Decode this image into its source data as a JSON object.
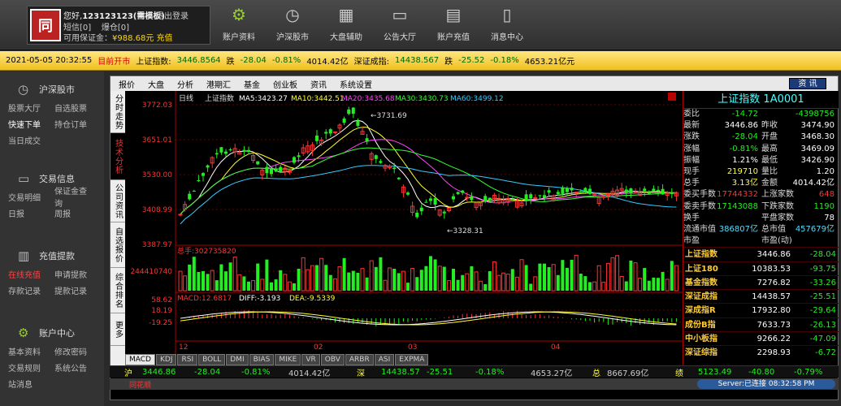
{
  "account": {
    "logo": "同",
    "greeting": "您好,",
    "user": "123123123(需模板)",
    "logout": "退出登录",
    "sms": "短信[0]",
    "alert": "爆仓[0]",
    "margin_label": "可用保证金：",
    "margin_value": "¥988.68元",
    "recharge": "充值"
  },
  "nav": [
    {
      "label": "账户资料",
      "icon": "gear-icon"
    },
    {
      "label": "沪深股市",
      "icon": "clock-icon"
    },
    {
      "label": "大盘辅助",
      "icon": "grid-icon"
    },
    {
      "label": "公告大厅",
      "icon": "monitor-icon"
    },
    {
      "label": "账户充值",
      "icon": "calendar-icon"
    },
    {
      "label": "消息中心",
      "icon": "message-icon"
    }
  ],
  "ticker": {
    "datetime": "2021-05-05 20:32:55",
    "market_status": "目前开市",
    "sh_name": "上证指数:",
    "sh_value": "3446.8564",
    "sh_dir": "跌",
    "sh_change": "-28.04",
    "sh_pct": "-0.81%",
    "sh_amount": "4014.42亿",
    "sz_name": "深证成指:",
    "sz_value": "14438.567",
    "sz_dir": "跌",
    "sz_change": "-25.52",
    "sz_pct": "-0.18%",
    "sz_amount": "4653.21亿元"
  },
  "sidebar": [
    {
      "title": "沪深股市",
      "icon": "clock-icon",
      "rows": [
        [
          "股票大厅",
          "自选股票"
        ],
        [
          "快速下单",
          "持仓订单"
        ],
        [
          "当日成交",
          ""
        ]
      ]
    },
    {
      "title": "交易信息",
      "icon": "monitor-icon",
      "rows": [
        [
          "交易明细",
          "保证金查询"
        ],
        [
          "日报",
          "周报"
        ]
      ]
    },
    {
      "title": "充值提款",
      "icon": "chart-icon",
      "rows": [
        [
          "在线充值",
          "申请提款"
        ],
        [
          "存款记录",
          "提款记录"
        ]
      ]
    },
    {
      "title": "账户中心",
      "icon": "gear-icon",
      "rows": [
        [
          "基本资料",
          "修改密码"
        ],
        [
          "交易规则",
          "系统公告"
        ],
        [
          "站消息",
          ""
        ]
      ]
    }
  ],
  "menu": [
    "报价",
    "大盘",
    "分析",
    "港期汇",
    "基金",
    "创业板",
    "资讯",
    "系统设置"
  ],
  "menu_button": "资 讯",
  "vtabs": [
    "分时走势",
    "技术分析",
    "公司资讯",
    "自选报价",
    "综合排名",
    "更多"
  ],
  "chart_labels": {
    "period": "日线",
    "index": "上证指数",
    "ma5": "MA5:3423.27",
    "ma10": "MA10:3442.51",
    "ma20": "MA20:3435.68",
    "ma30": "MA30:3430.73",
    "ma60": "MA60:3499.12",
    "hi_label": "3731.69",
    "lo_label": "3328.31",
    "vol_label": "总手:302735820",
    "vol_axis": "244410740",
    "macd": "MACD:12.6817",
    "diff": "DIFF:-3.193",
    "dea": "DEA:-9.5339"
  },
  "price_ticks": [
    "3772.03",
    "3651.01",
    "3530.00",
    "3408.99",
    "3387.97"
  ],
  "macd_ticks": [
    "58.62",
    "18.19",
    "-19.25"
  ],
  "date_ticks": [
    "12",
    "02",
    "03",
    "04"
  ],
  "bottom_tabs": [
    "MACD",
    "KDJ",
    "RSI",
    "BOLL",
    "DMI",
    "BIAS",
    "MIKE",
    "VR",
    "OBV",
    "ARBR",
    "ASI",
    "EXPMA"
  ],
  "quote": {
    "title": "上证指数 1A0001",
    "rows": [
      {
        "k": "委比",
        "v": "-14.72",
        "vc": "grn",
        "k2": "",
        "v2": "-4398756",
        "v2c": "grn"
      },
      {
        "k": "最新",
        "v": "3446.86",
        "vc": "wht",
        "k2": "昨收",
        "v2": "3474.90",
        "v2c": "wht"
      },
      {
        "k": "涨跌",
        "v": "-28.04",
        "vc": "grn",
        "k2": "开盘",
        "v2": "3468.30",
        "v2c": "wht"
      },
      {
        "k": "涨幅",
        "v": "-0.81%",
        "vc": "grn",
        "k2": "最高",
        "v2": "3469.09",
        "v2c": "wht"
      },
      {
        "k": "振幅",
        "v": "1.21%",
        "vc": "wht",
        "k2": "最低",
        "v2": "3426.90",
        "v2c": "wht"
      },
      {
        "k": "现手",
        "v": "219710",
        "vc": "yel",
        "k2": "量比",
        "v2": "1.20",
        "v2c": "wht"
      },
      {
        "k": "总手",
        "v": "3.13亿",
        "vc": "yel",
        "k2": "金额",
        "v2": "4014.42亿",
        "v2c": "wht"
      },
      {
        "k": "委买手数",
        "v": "17744332",
        "vc": "red",
        "k2": "上涨家数",
        "v2": "648",
        "v2c": "red"
      },
      {
        "k": "委卖手数",
        "v": "17143088",
        "vc": "grn",
        "k2": "下跌家数",
        "v2": "1190",
        "v2c": "grn"
      },
      {
        "k": "换手",
        "v": "",
        "vc": "wht",
        "k2": "平盘家数",
        "v2": "78",
        "v2c": "wht"
      },
      {
        "k": "流通市值",
        "v": "386807亿",
        "vc": "blu",
        "k2": "总市值",
        "v2": "457679亿",
        "v2c": "blu"
      },
      {
        "k": "市盈",
        "v": "",
        "vc": "wht",
        "k2": "市盈(动)",
        "v2": "",
        "v2c": "wht"
      }
    ],
    "indices": [
      {
        "n": "上证指数",
        "p": "3446.86",
        "c": "-28.04"
      },
      {
        "n": "上证180",
        "p": "10383.53",
        "c": "-93.75"
      },
      {
        "n": "基金指数",
        "p": "7276.82",
        "c": "-33.26"
      },
      {
        "n": "深证成指",
        "p": "14438.57",
        "c": "-25.51"
      },
      {
        "n": "深成指R",
        "p": "17932.80",
        "c": "-29.64"
      },
      {
        "n": "成份B指",
        "p": "7633.73",
        "c": "-26.13"
      },
      {
        "n": "中小板指",
        "p": "9266.22",
        "c": "-47.09"
      },
      {
        "n": "深证综指",
        "p": "2298.93",
        "c": "-6.72"
      }
    ]
  },
  "status": {
    "sh": "沪",
    "sh_p": "3446.86",
    "sh_c": "-28.04",
    "sh_pct": "-0.81%",
    "sh_amt": "4014.42亿",
    "sz": "深",
    "sz_p": "14438.57",
    "sz_c": "-25.51",
    "sz_pct": "-0.18%",
    "sz_amt": "4653.27亿",
    "tot": "总",
    "tot_amt": "8667.69亿",
    "cy": "绩",
    "cy_p": "5123.49",
    "cy_c": "-40.80",
    "cy_pct": "-0.79%"
  },
  "footer": {
    "brand": "同花顺",
    "server": "Server:已连接 08:32:58 PM"
  },
  "colors": {
    "up": "#ff3333",
    "down": "#22ee22",
    "ma5": "#ffffff",
    "ma10": "#ffff33",
    "ma20": "#ff44ff",
    "ma30": "#33ff33",
    "ma60": "#33ccff"
  }
}
